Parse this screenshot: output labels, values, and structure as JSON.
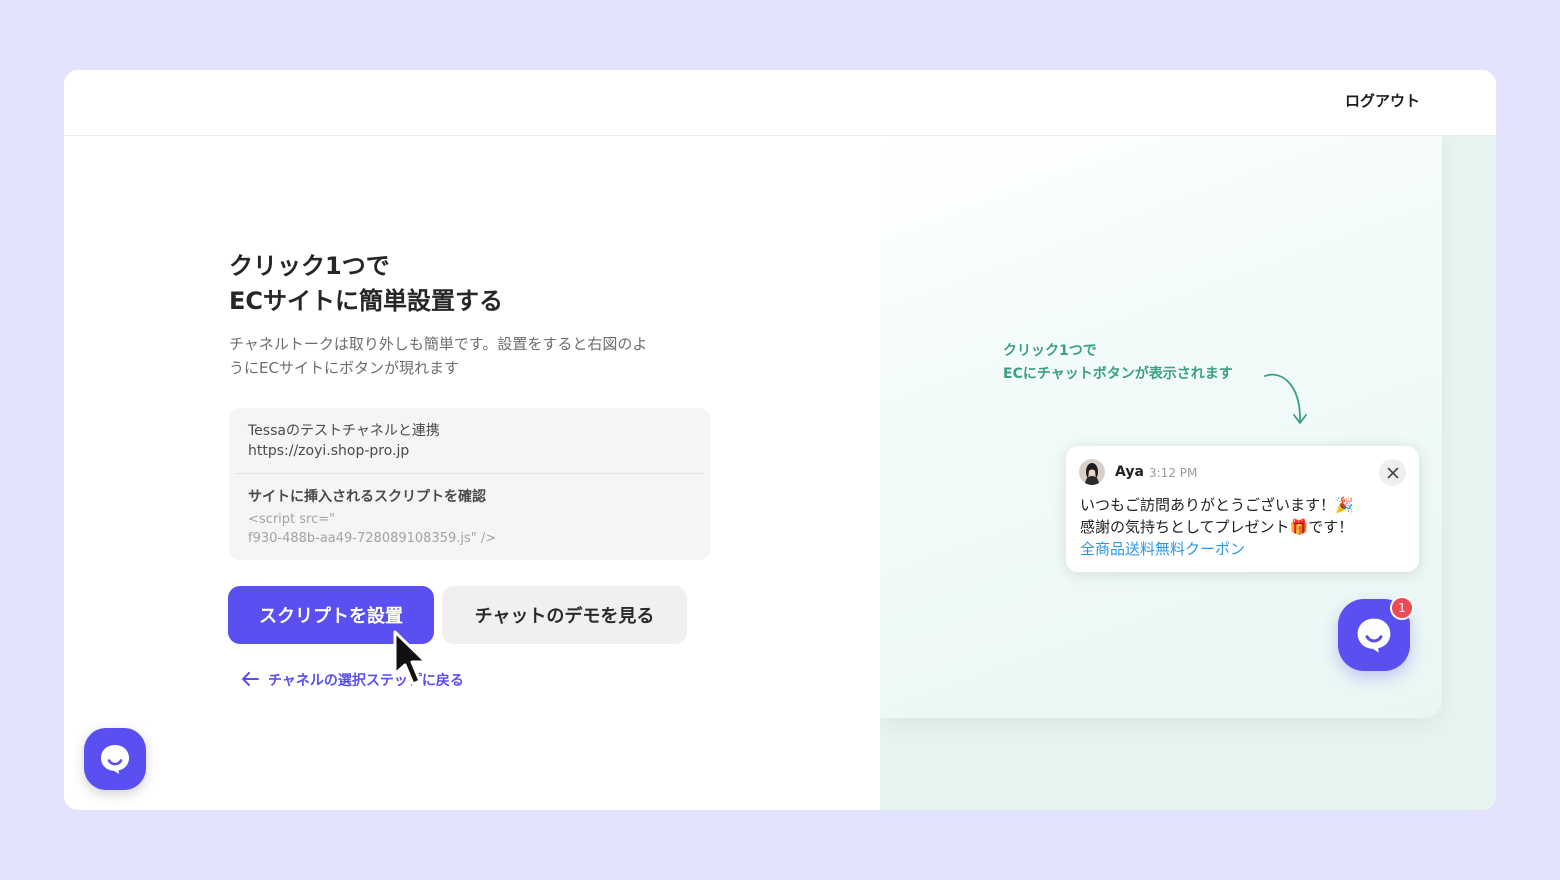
{
  "header": {
    "logout_label": "ログアウト"
  },
  "main": {
    "title_line1": "クリック1つで",
    "title_line2": "ECサイトに簡単設置する",
    "description_line1": "チャネルトークは取り外しも簡単です。設置をすると右図のよ",
    "description_line2": "うにECサイトにボタンが現れます",
    "info": {
      "channel_name": "Tessaのテストチャネルと連携",
      "channel_url": "https://zoyi.shop-pro.jp",
      "script_heading": "サイトに挿入されるスクリプトを確認",
      "script_line1": "<script src=\"",
      "script_line2": "f930-488b-aa49-728089108359.js\" />"
    },
    "install_button_label": "スクリプトを設置",
    "demo_button_label": "チャットのデモを見る",
    "back_link_label": "チャネルの選択ステップに戻る"
  },
  "preview": {
    "annotation_line1": "クリック1つで",
    "annotation_line2": "ECにチャットボタンが表示されます",
    "popup": {
      "sender": "Aya",
      "time": "3:12 PM",
      "message_line1": "いつもご訪問ありがとうございます！🎉",
      "message_line2": "感謝の気持ちとしてプレゼント🎁です！",
      "link_text": "全商品送料無料クーポン"
    },
    "badge_count": "1"
  },
  "colors": {
    "brand": "#5a4ff0",
    "page_background": "#e3e3fd",
    "preview_background": "#e6f5f2",
    "annotation": "#3b9e86",
    "link": "#2b96e8",
    "badge": "#ec4a54"
  }
}
